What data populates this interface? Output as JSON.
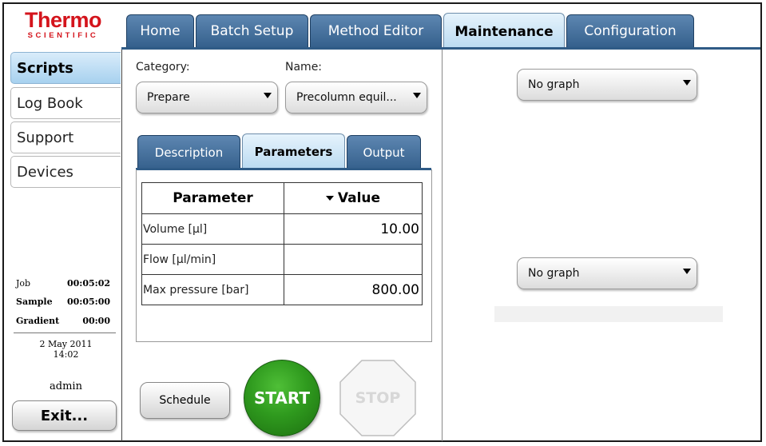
{
  "logo": {
    "brand": "Thermo",
    "sub": "SCIENTIFIC",
    "color": "#d4141c"
  },
  "top_tabs": [
    {
      "label": "Home"
    },
    {
      "label": "Batch Setup"
    },
    {
      "label": "Method Editor"
    },
    {
      "label": "Maintenance",
      "active": true
    },
    {
      "label": "Configuration"
    }
  ],
  "sidebar": {
    "items": [
      {
        "label": "Scripts",
        "active": true
      },
      {
        "label": "Log Book"
      },
      {
        "label": "Support"
      },
      {
        "label": "Devices"
      }
    ],
    "status": [
      {
        "key": "Job",
        "value": "00:05:02"
      },
      {
        "key": "Sample",
        "value": "00:05:00"
      },
      {
        "key": "Gradient",
        "value": "00:00"
      }
    ],
    "date": "2 May 2011",
    "time": "14:02",
    "user": "admin",
    "exit_label": "Exit..."
  },
  "script": {
    "category_label": "Category:",
    "category_value": "Prepare",
    "name_label": "Name:",
    "name_value": "Precolumn equil..."
  },
  "sub_tabs": [
    {
      "label": "Description"
    },
    {
      "label": "Parameters",
      "active": true
    },
    {
      "label": "Output"
    }
  ],
  "params_table": {
    "headers": [
      "Parameter",
      "Value"
    ],
    "rows": [
      {
        "parameter": "Volume [µl]",
        "value": "10.00"
      },
      {
        "parameter": "Flow [µl/min]",
        "value": ""
      },
      {
        "parameter": "Max pressure [bar]",
        "value": "800.00"
      }
    ]
  },
  "actions": {
    "schedule_label": "Schedule",
    "start_label": "START",
    "stop_label": "STOP"
  },
  "graphs": [
    {
      "value": "No graph"
    },
    {
      "value": "No graph"
    }
  ],
  "colors": {
    "tab_blue": "#35608c",
    "tab_active": "#b9daf1",
    "start_green": "#2f9a1e"
  }
}
